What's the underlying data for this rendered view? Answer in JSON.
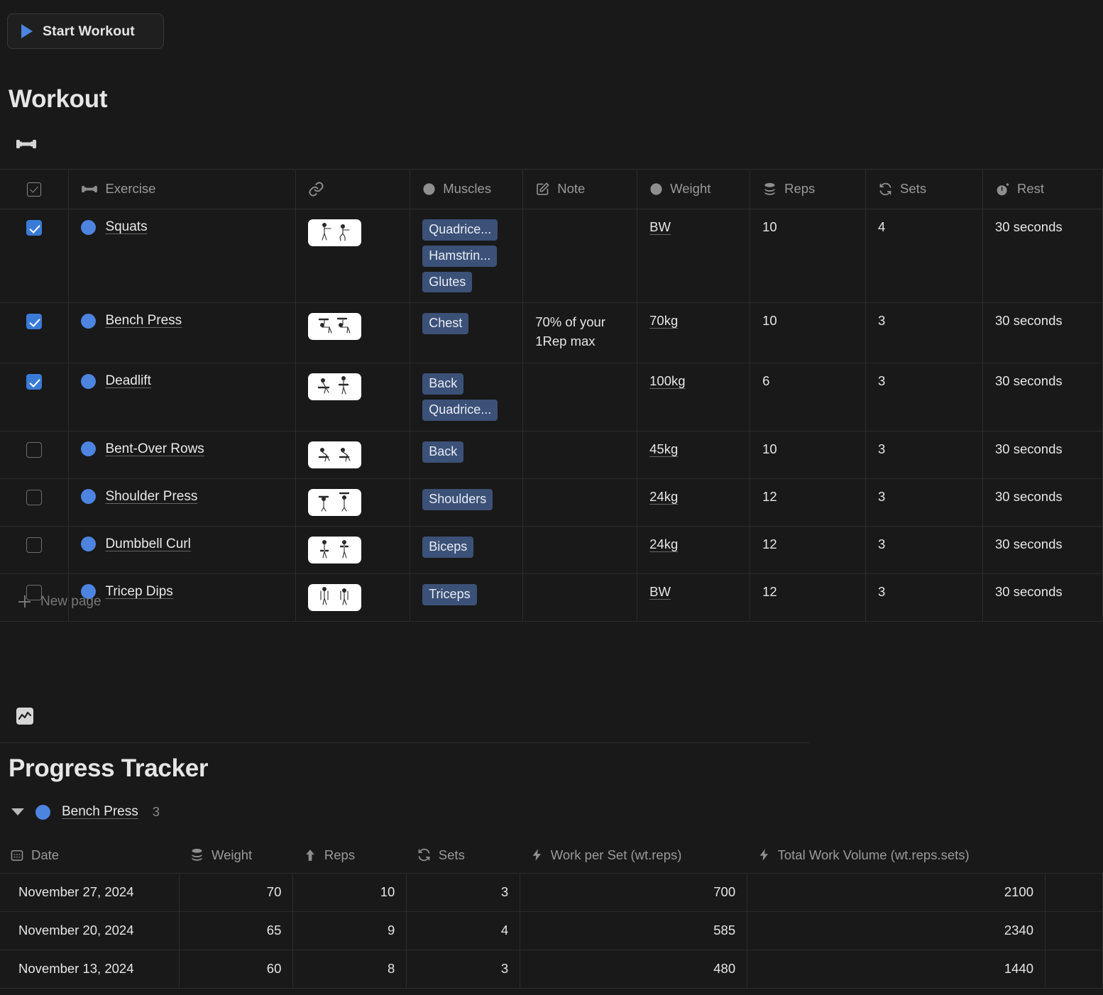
{
  "toolbar": {
    "start_workout_label": "Start Workout",
    "play_icon": "play-icon"
  },
  "workout": {
    "title": "Workout",
    "section_icon": "dumbbell-icon",
    "columns": [
      {
        "key": "check",
        "label": "",
        "icon": "checkbox-icon"
      },
      {
        "key": "exercise",
        "label": "Exercise",
        "icon": "dumbbell-icon"
      },
      {
        "key": "link",
        "label": "",
        "icon": "link-icon"
      },
      {
        "key": "muscles",
        "label": "Muscles",
        "icon": "circle-icon"
      },
      {
        "key": "note",
        "label": "Note",
        "icon": "edit-icon"
      },
      {
        "key": "weight",
        "label": "Weight",
        "icon": "circle-icon"
      },
      {
        "key": "reps",
        "label": "Reps",
        "icon": "stack-icon"
      },
      {
        "key": "sets",
        "label": "Sets",
        "icon": "repeat-icon"
      },
      {
        "key": "rest",
        "label": "Rest",
        "icon": "stopwatch-icon"
      }
    ],
    "rows": [
      {
        "checked": true,
        "name": "Squats",
        "thumb": "squat-figure-thumbnail",
        "muscles": [
          "Quadrice...",
          "Hamstrin...",
          "Glutes"
        ],
        "note": "",
        "weight": "BW",
        "reps": "10",
        "sets": "4",
        "rest": "30 seconds"
      },
      {
        "checked": true,
        "name": "Bench Press",
        "thumb": "bench-press-figure-thumbnail",
        "muscles": [
          "Chest"
        ],
        "note": "70% of your 1Rep max",
        "weight": "70kg",
        "reps": "10",
        "sets": "3",
        "rest": "30 seconds"
      },
      {
        "checked": true,
        "name": "Deadlift",
        "thumb": "deadlift-figure-thumbnail",
        "muscles": [
          "Back",
          "Quadrice..."
        ],
        "note": "",
        "weight": "100kg",
        "reps": "6",
        "sets": "3",
        "rest": "30 seconds"
      },
      {
        "checked": false,
        "name": "Bent-Over Rows",
        "thumb": "bent-over-row-figure-thumbnail",
        "muscles": [
          "Back"
        ],
        "note": "",
        "weight": "45kg",
        "reps": "10",
        "sets": "3",
        "rest": "30 seconds"
      },
      {
        "checked": false,
        "name": "Shoulder Press",
        "thumb": "shoulder-press-figure-thumbnail",
        "muscles": [
          "Shoulders"
        ],
        "note": "",
        "weight": "24kg",
        "reps": "12",
        "sets": "3",
        "rest": "30 seconds"
      },
      {
        "checked": false,
        "name": "Dumbbell Curl",
        "thumb": "dumbbell-curl-figure-thumbnail",
        "muscles": [
          "Biceps"
        ],
        "note": "",
        "weight": "24kg",
        "reps": "12",
        "sets": "3",
        "rest": "30 seconds"
      },
      {
        "checked": false,
        "name": "Tricep Dips",
        "thumb": "tricep-dip-figure-thumbnail",
        "muscles": [
          "Triceps"
        ],
        "note": "",
        "weight": "BW",
        "reps": "12",
        "sets": "3",
        "rest": "30 seconds"
      }
    ],
    "new_page_label": "New page"
  },
  "progress": {
    "title": "Progress Tracker",
    "section_icon": "line-chart-icon",
    "group": {
      "name": "Bench Press",
      "count": "3",
      "expanded": true
    },
    "columns": [
      {
        "key": "date",
        "label": "Date",
        "icon": "calendar-icon"
      },
      {
        "key": "weight",
        "label": "Weight",
        "icon": "stack-icon"
      },
      {
        "key": "reps",
        "label": "Reps",
        "icon": "arrow-up-icon"
      },
      {
        "key": "sets",
        "label": "Sets",
        "icon": "repeat-icon"
      },
      {
        "key": "wps",
        "label": "Work per Set (wt.reps)",
        "icon": "bolt-icon"
      },
      {
        "key": "twv",
        "label": "Total Work Volume (wt.reps.sets)",
        "icon": "bolt-icon"
      }
    ],
    "rows": [
      {
        "date": "November 27, 2024",
        "weight": "70",
        "reps": "10",
        "sets": "3",
        "wps": "700",
        "twv": "2100"
      },
      {
        "date": "November 20, 2024",
        "weight": "65",
        "reps": "9",
        "sets": "4",
        "wps": "585",
        "twv": "2340"
      },
      {
        "date": "November 13, 2024",
        "weight": "60",
        "reps": "8",
        "sets": "3",
        "wps": "480",
        "twv": "1440"
      }
    ]
  },
  "colors": {
    "background": "#191919",
    "accent_blue": "#4d84e0",
    "checkbox_blue": "#3a7bd8",
    "tag_bg": "#3c5177",
    "text": "#e6e6e6",
    "muted_text": "#9a9a9a",
    "border": "#2c2c2c"
  }
}
